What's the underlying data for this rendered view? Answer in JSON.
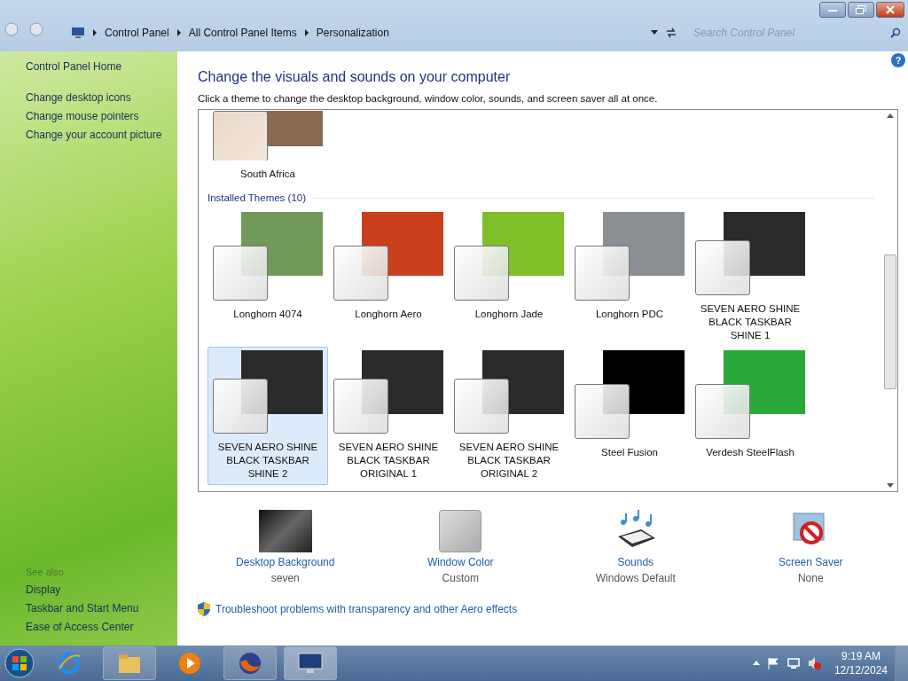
{
  "address_bar": {
    "crumbs": [
      "Control Panel",
      "All Control Panel Items",
      "Personalization"
    ],
    "search_placeholder": "Search Control Panel"
  },
  "sidebar": {
    "home": "Control Panel Home",
    "links": [
      "Change desktop icons",
      "Change mouse pointers",
      "Change your account picture"
    ],
    "see_also_title": "See also",
    "see_also": [
      "Display",
      "Taskbar and Start Menu",
      "Ease of Access Center"
    ]
  },
  "main": {
    "help": "?",
    "title": "Change the visuals and sounds on your computer",
    "subtitle": "Click a theme to change the desktop background, window color, sounds, and screen saver all at once.",
    "top_theme": {
      "name": "South Africa",
      "color": "#8a6a50"
    },
    "group_title": "Installed Themes (10)",
    "themes": [
      {
        "name": "Longhorn 4074",
        "selected": false,
        "color": "#6f9a5a"
      },
      {
        "name": "Longhorn Aero",
        "selected": false,
        "color": "#c8401c"
      },
      {
        "name": "Longhorn Jade",
        "selected": false,
        "color": "#7fbf2a"
      },
      {
        "name": "Longhorn PDC",
        "selected": false,
        "color": "#8a8f94"
      },
      {
        "name": "SEVEN AERO SHINE BLACK TASKBAR SHINE 1",
        "selected": false,
        "color": "#2a2a2a"
      },
      {
        "name": "SEVEN AERO SHINE BLACK TASKBAR SHINE 2",
        "selected": true,
        "color": "#2a2a2a"
      },
      {
        "name": "SEVEN AERO SHINE BLACK TASKBAR ORIGINAL 1",
        "selected": false,
        "color": "#2a2a2a"
      },
      {
        "name": "SEVEN AERO SHINE BLACK TASKBAR ORIGINAL 2",
        "selected": false,
        "color": "#2a2a2a"
      },
      {
        "name": "Steel Fusion",
        "selected": false,
        "color": "#000000"
      },
      {
        "name": "Verdesh SteelFlash",
        "selected": false,
        "color": "#2aa83a"
      }
    ],
    "settings": [
      {
        "kind": "background",
        "label": "Desktop Background",
        "value": "seven"
      },
      {
        "kind": "color",
        "label": "Window Color",
        "value": "Custom"
      },
      {
        "kind": "sounds",
        "label": "Sounds",
        "value": "Windows Default"
      },
      {
        "kind": "saver",
        "label": "Screen Saver",
        "value": "None"
      }
    ],
    "troubleshoot": "Troubleshoot problems with transparency and other Aero effects"
  },
  "taskbar": {
    "time": "9:19 AM",
    "date": "12/12/2024"
  }
}
